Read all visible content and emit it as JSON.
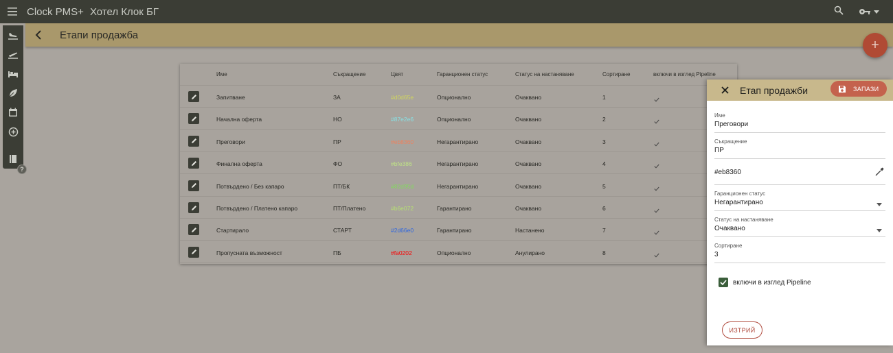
{
  "topbar": {
    "app_title": "Clock PMS+",
    "hotel_title": "Хотел Клок БГ"
  },
  "page": {
    "title": "Етапи продажба"
  },
  "help": {
    "label": "?"
  },
  "fab": {
    "label": "+"
  },
  "table": {
    "headers": {
      "name": "Име",
      "short": "Съкращение",
      "color": "Цвят",
      "guarantee": "Гаранционен статус",
      "accommodation": "Статус на настаняване",
      "sort": "Сортиране",
      "pipeline": "включи в изглед Pipeline"
    },
    "rows": [
      {
        "name": "Запитване",
        "short": "ЗА",
        "color": "#d0d65e",
        "guarantee": "Опционално",
        "accommodation": "Очаквано",
        "sort": "1"
      },
      {
        "name": "Начална оферта",
        "short": "НО",
        "color": "#87e2e6",
        "guarantee": "Опционално",
        "accommodation": "Очаквано",
        "sort": "2"
      },
      {
        "name": "Преговори",
        "short": "ПР",
        "color": "#eb8360",
        "guarantee": "Негарантирано",
        "accommodation": "Очаквано",
        "sort": "3"
      },
      {
        "name": "Финална оферта",
        "short": "ФО",
        "color": "#bfe386",
        "guarantee": "Негарантирано",
        "accommodation": "Очаквано",
        "sort": "4"
      },
      {
        "name": "Потвърдено / Без капаро",
        "short": "ПТ/БК",
        "color": "#82d95d",
        "guarantee": "Негарантирано",
        "accommodation": "Очаквано",
        "sort": "5"
      },
      {
        "name": "Потвърдено / Платено капаро",
        "short": "ПТ/Платено",
        "color": "#b6e072",
        "guarantee": "Гарантирано",
        "accommodation": "Очаквано",
        "sort": "6"
      },
      {
        "name": "Стартирало",
        "short": "СТАРТ",
        "color": "#2d66e0",
        "guarantee": "Гарантирано",
        "accommodation": "Настанено",
        "sort": "7"
      },
      {
        "name": "Пропусната възможност",
        "short": "ПБ",
        "color": "#fa0202",
        "guarantee": "Опционално",
        "accommodation": "Анулирано",
        "sort": "8"
      }
    ]
  },
  "panel": {
    "title": "Етап продажби",
    "save_label": "ЗАПАЗИ",
    "name_label": "Име",
    "name_value": "Преговори",
    "short_label": "Съкращение",
    "short_value": "ПР",
    "color_value": "#eb8360",
    "guarantee_label": "Гаранционен статус",
    "guarantee_value": "Негарантирано",
    "accommodation_label": "Статус на настаняване",
    "accommodation_value": "Очаквано",
    "sort_label": "Сортиране",
    "sort_value": "3",
    "pipeline_label": "включи в изглед Pipeline",
    "pipeline_checked": true,
    "delete_label": "ИЗТРИЙ"
  },
  "colors": {
    "topbar": "#3b3d35",
    "header": "#a9986b",
    "panel_header": "#c8b88c",
    "accent": "#b04a34"
  }
}
